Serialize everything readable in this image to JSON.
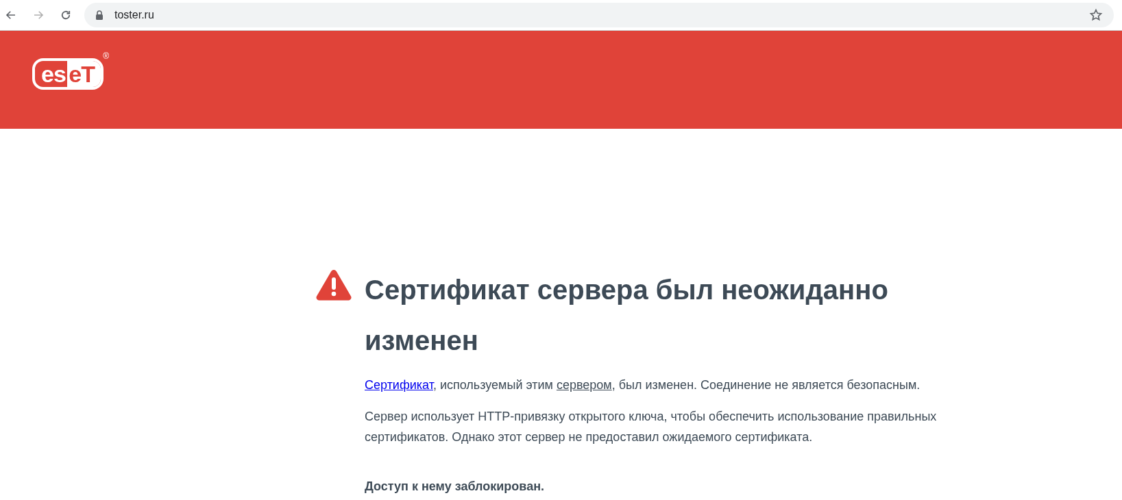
{
  "browser": {
    "url": "toster.ru",
    "back_disabled": false,
    "forward_disabled": true
  },
  "header": {
    "logo": {
      "left": "es",
      "right": "eT",
      "mark": "®"
    }
  },
  "warning": {
    "title": "Сертификат сервера был неожиданно изменен",
    "paragraph_1": [
      {
        "kind": "link",
        "text": "Сертификат",
        "visited": false
      },
      {
        "kind": "plain",
        "text": ", используемый этим "
      },
      {
        "kind": "link",
        "text": "сервером",
        "visited": true
      },
      {
        "kind": "plain",
        "text": ", был изменен. Соединение не является безопасным."
      }
    ],
    "paragraph_2": "Сервер использует HTTP-привязку открытого ключа, чтобы обеспечить использование правильных сертификатов. Однако этот сервер не предоставил ожидаемого сертификата.",
    "blocked": "Доступ к нему заблокирован."
  }
}
